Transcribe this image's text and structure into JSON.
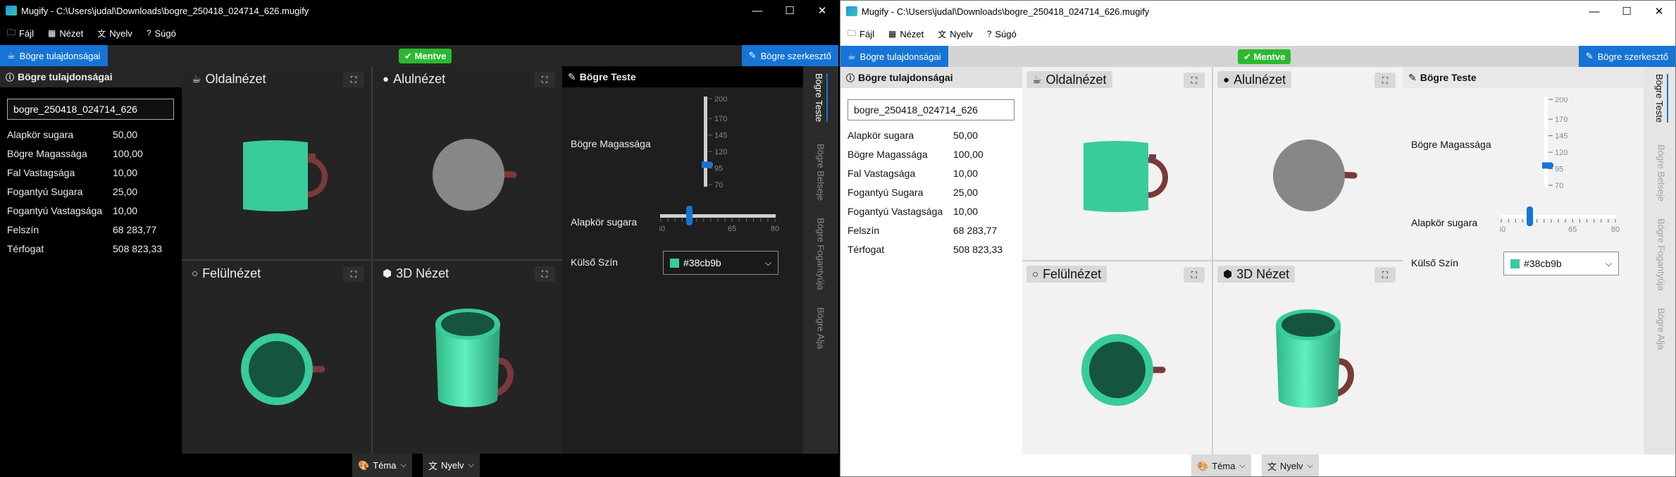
{
  "app": {
    "title": "Mugify - C:\\Users\\judal\\Downloads\\bogre_250418_024714_626.mugify",
    "window_controls": {
      "minimize": "—",
      "maximize": "☐",
      "close": "✕"
    }
  },
  "menu": [
    {
      "icon": "folder-icon",
      "glyph": "🗀",
      "label": "Fájl"
    },
    {
      "icon": "grid-icon",
      "glyph": "▦",
      "label": "Nézet"
    },
    {
      "icon": "language-icon",
      "glyph": "文",
      "label": "Nyelv"
    },
    {
      "icon": "help-icon",
      "glyph": "?",
      "label": "Súgó"
    }
  ],
  "toolbar": {
    "properties_tab": "Bögre tulajdonságai",
    "saved_badge": "✔ Mentve",
    "editor_button": "Bögre szerkesztő"
  },
  "properties": {
    "title": "Bögre tulajdonságai",
    "name_value": "bogre_250418_024714_626",
    "rows": [
      {
        "label": "Alapkör sugara",
        "value": "50,00"
      },
      {
        "label": "Bögre Magassága",
        "value": "100,00"
      },
      {
        "label": "Fal Vastagsága",
        "value": "10,00"
      },
      {
        "label": "Fogantyú Sugara",
        "value": "25,00"
      },
      {
        "label": "Fogantyú Vastagsága",
        "value": "10,00"
      },
      {
        "label": "Felszín",
        "value": "68 283,77"
      },
      {
        "label": "Térfogat",
        "value": "508 823,33"
      }
    ]
  },
  "views": {
    "side": "Oldalnézet",
    "bottom": "Alulnézet",
    "top": "Felülnézet",
    "three_d": "3D Nézet"
  },
  "editor": {
    "title": "Bögre Teste",
    "height_label": "Bögre Magassága",
    "height_slider": {
      "min": 70,
      "max": 200,
      "value": 100,
      "ticks": [
        "200",
        "170",
        "145",
        "120",
        "95",
        "70"
      ]
    },
    "radius_label": "Alapkör sugara",
    "radius_slider": {
      "min": 40,
      "max": 80,
      "value": 50,
      "ticks": [
        "40",
        "65",
        "80"
      ]
    },
    "color_label": "Külső Szín",
    "color_value": "#38cb9b"
  },
  "side_tabs": [
    "Bögre Teste",
    "Bögre Belseje",
    "Bögre Fogantyúja",
    "Bögre Alja"
  ],
  "status": {
    "theme": "Téma",
    "language": "Nyelv"
  },
  "colors": {
    "accent": "#1674d6",
    "saved": "#2bba2f",
    "mug_body": "#38cb9b",
    "mug_inner": "#15553d",
    "handle": "#7a3a3a",
    "bottom_disc": "#878787"
  }
}
